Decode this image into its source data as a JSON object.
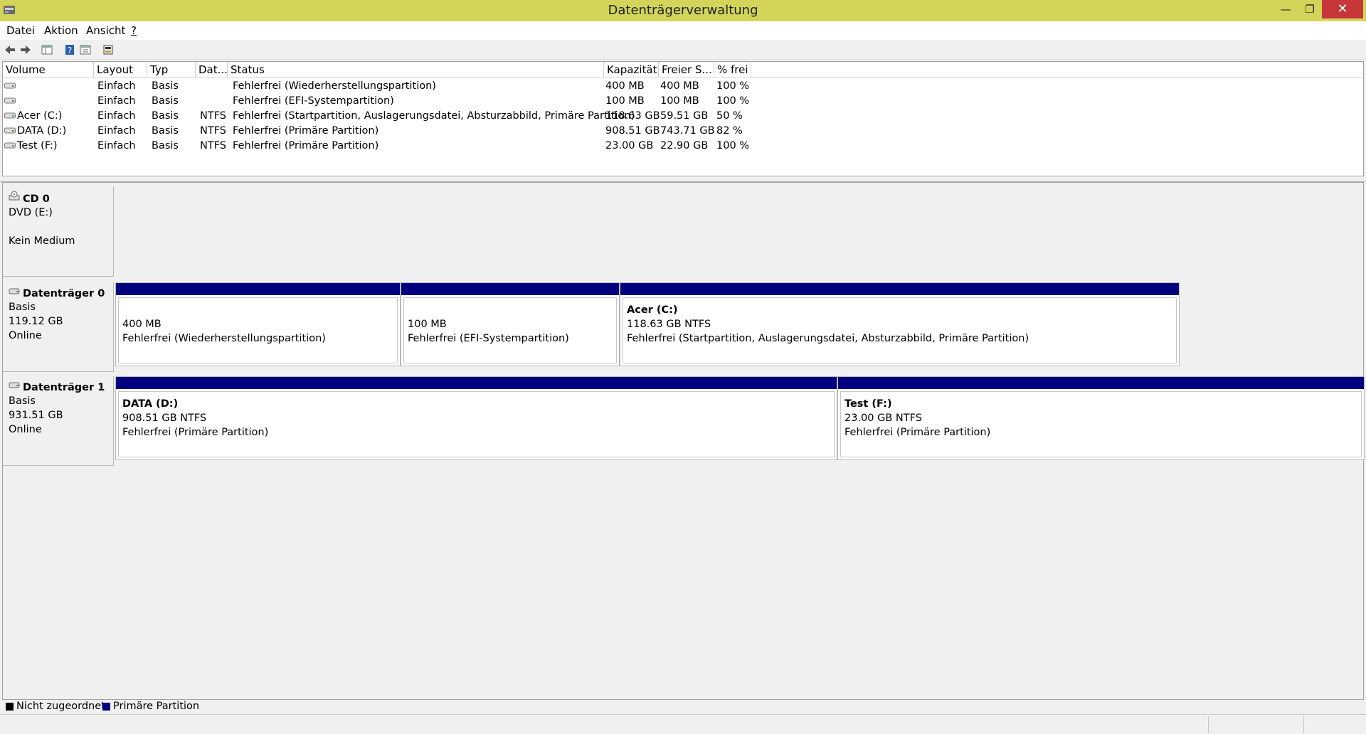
{
  "window": {
    "title": "Datenträgerverwaltung",
    "minimize_glyph": "—",
    "maximize_glyph": "❐",
    "close_glyph": "✕"
  },
  "menu": [
    {
      "label": "Datei"
    },
    {
      "label": "Aktion"
    },
    {
      "label": "Ansicht"
    },
    {
      "label": "?"
    }
  ],
  "toolbar": [
    {
      "icon": "back-arrow-icon"
    },
    {
      "icon": "forward-arrow-icon"
    },
    {
      "icon": "console-tree-icon"
    },
    {
      "icon": "help-icon"
    },
    {
      "icon": "properties-icon"
    },
    {
      "icon": "disk-settings-icon"
    }
  ],
  "volume_list": {
    "columns": [
      "Volume",
      "Layout",
      "Typ",
      "Dat...",
      "Status",
      "Kapazität",
      "Freier S...",
      "% frei"
    ],
    "rows": [
      {
        "volume": "",
        "layout": "Einfach",
        "type": "Basis",
        "fs": "",
        "status": "Fehlerfrei (Wiederherstellungspartition)",
        "capacity": "400 MB",
        "free": "400 MB",
        "pct": "100 %"
      },
      {
        "volume": "",
        "layout": "Einfach",
        "type": "Basis",
        "fs": "",
        "status": "Fehlerfrei (EFI-Systempartition)",
        "capacity": "100 MB",
        "free": "100 MB",
        "pct": "100 %"
      },
      {
        "volume": "Acer (C:)",
        "layout": "Einfach",
        "type": "Basis",
        "fs": "NTFS",
        "status": "Fehlerfrei (Startpartition, Auslagerungsdatei, Absturzabbild, Primäre Partition)",
        "capacity": "118.63 GB",
        "free": "59.51 GB",
        "pct": "50 %"
      },
      {
        "volume": "DATA (D:)",
        "layout": "Einfach",
        "type": "Basis",
        "fs": "NTFS",
        "status": "Fehlerfrei (Primäre Partition)",
        "capacity": "908.51 GB",
        "free": "743.71 GB",
        "pct": "82 %"
      },
      {
        "volume": "Test (F:)",
        "layout": "Einfach",
        "type": "Basis",
        "fs": "NTFS",
        "status": "Fehlerfrei (Primäre Partition)",
        "capacity": "23.00 GB",
        "free": "22.90 GB",
        "pct": "100 %"
      }
    ]
  },
  "disks": {
    "cd0": {
      "name": "CD 0",
      "line1": "DVD (E:)",
      "line2": "Kein Medium"
    },
    "disk0": {
      "name": "Datenträger 0",
      "type": "Basis",
      "size": "119.12 GB",
      "state": "Online",
      "partitions": [
        {
          "label": "",
          "size": "400 MB",
          "status": "Fehlerfrei (Wiederherstellungspartition)"
        },
        {
          "label": "",
          "size": "100 MB",
          "status": "Fehlerfrei (EFI-Systempartition)"
        },
        {
          "label": "Acer  (C:)",
          "size": "118.63 GB NTFS",
          "status": "Fehlerfrei (Startpartition, Auslagerungsdatei, Absturzabbild, Primäre Partition)"
        }
      ]
    },
    "disk1": {
      "name": "Datenträger 1",
      "type": "Basis",
      "size": "931.51 GB",
      "state": "Online",
      "partitions": [
        {
          "label": "DATA  (D:)",
          "size": "908.51 GB NTFS",
          "status": "Fehlerfrei (Primäre Partition)"
        },
        {
          "label": "Test  (F:)",
          "size": "23.00 GB NTFS",
          "status": "Fehlerfrei (Primäre Partition)"
        }
      ]
    }
  },
  "legend": [
    {
      "label": "Nicht zugeordnet",
      "color": "#000000"
    },
    {
      "label": "Primäre Partition",
      "color": "#00007f"
    }
  ]
}
